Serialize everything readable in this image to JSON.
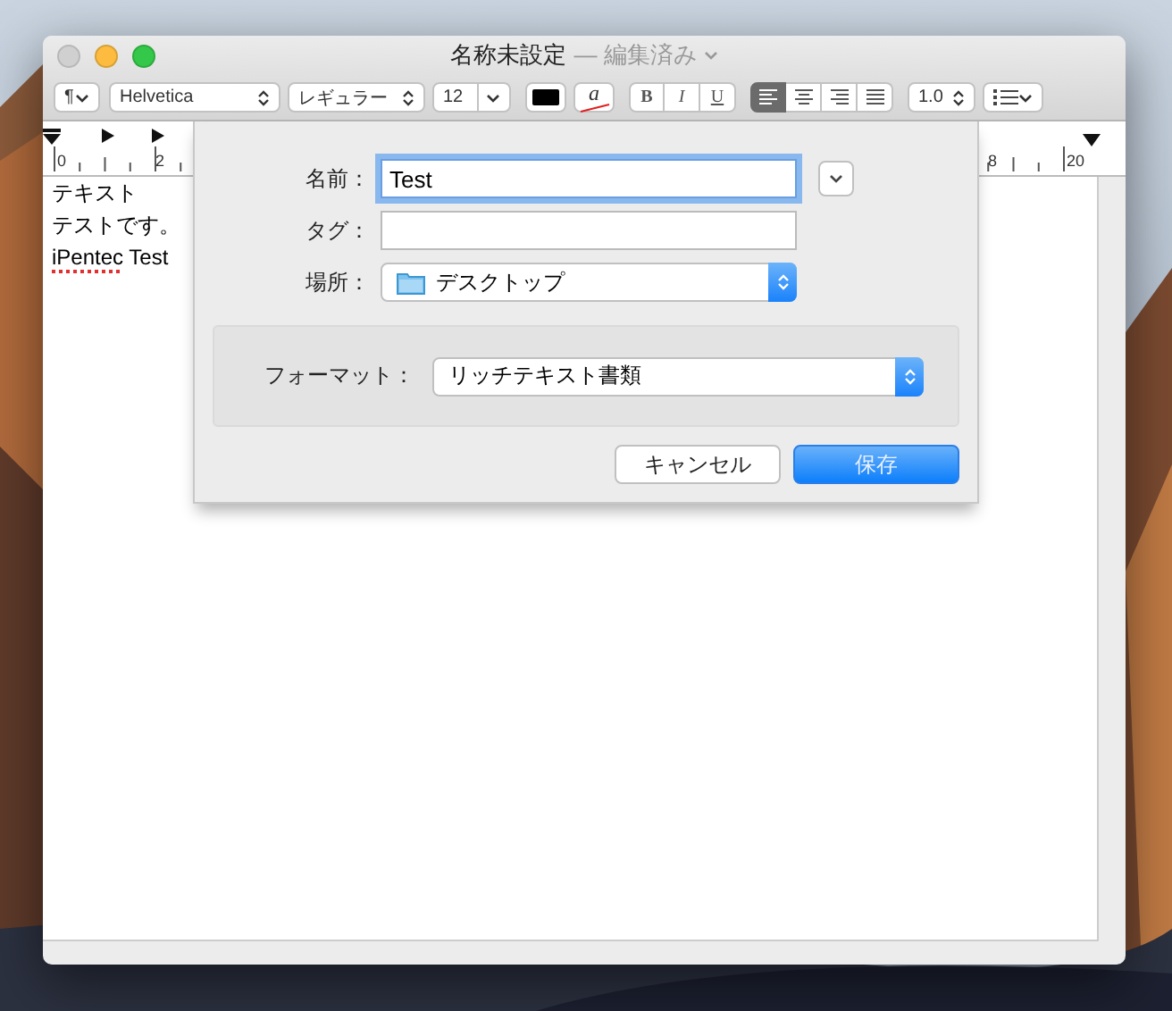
{
  "window": {
    "title": "名称未設定",
    "status": "— 編集済み",
    "buttons": [
      {
        "kind": "close",
        "disabled": true
      },
      {
        "kind": "minimize",
        "disabled": false
      },
      {
        "kind": "zoom",
        "disabled": false
      }
    ]
  },
  "toolbar": {
    "paragraph": "¶",
    "font": "Helvetica",
    "style": "レギュラー",
    "size": "12",
    "highlight": "a",
    "bold": "B",
    "italic": "I",
    "underline": "U",
    "alignments": [
      {
        "kind": "left",
        "selected": true
      },
      {
        "kind": "center",
        "selected": false
      },
      {
        "kind": "right",
        "selected": false
      },
      {
        "kind": "justify",
        "selected": false
      }
    ],
    "spacing": "1.0"
  },
  "ruler": {
    "labels": [
      "0",
      "2",
      "8",
      "20"
    ]
  },
  "document": {
    "lines": [
      {
        "runs": [
          {
            "text": "テキスト",
            "misspelled": false
          }
        ]
      },
      {
        "runs": [
          {
            "text": "テストです。",
            "misspelled": false
          }
        ]
      },
      {
        "runs": [
          {
            "text": "iPentec",
            "misspelled": true
          },
          {
            "text": " Test",
            "misspelled": false
          }
        ]
      }
    ]
  },
  "sheet": {
    "name_label": "名前：",
    "name_value": "Test",
    "tags_label": "タグ：",
    "location_label": "場所：",
    "location_value": "デスクトップ",
    "format_label": "フォーマット：",
    "format_value": "リッチテキスト書類",
    "buttons": [
      {
        "label": "キャンセル",
        "default": false
      },
      {
        "label": "保存",
        "default": true
      }
    ]
  }
}
